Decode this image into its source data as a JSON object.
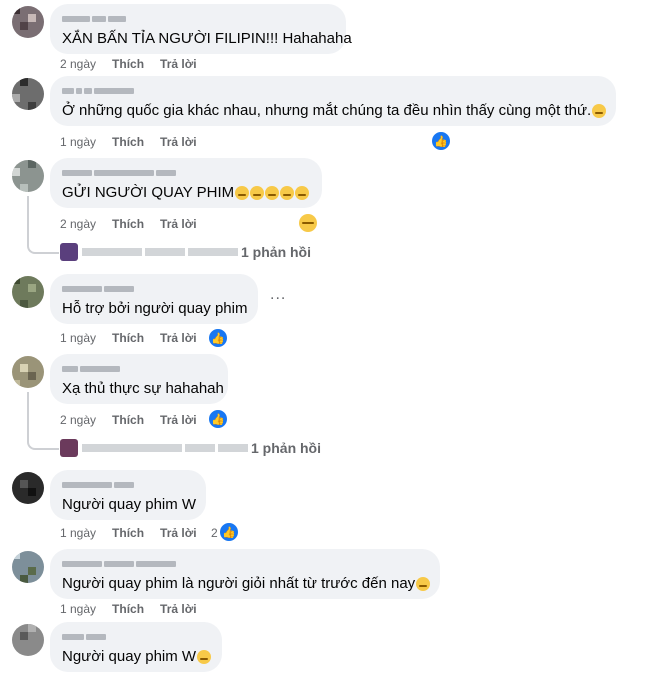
{
  "comments": [
    {
      "text": "XẮN BẤN TỈA NGƯỜI FILIPIN!!! Hahahaha",
      "time": "2 ngày",
      "like": "Thích",
      "reply": "Trả lời"
    },
    {
      "text": "Ở những quốc gia khác nhau, nhưng mắt chúng ta đều nhìn thấy cùng một thứ.",
      "time": "1 ngày",
      "like": "Thích",
      "reply": "Trả lời"
    },
    {
      "text": "GỬI NGƯỜI QUAY PHIM",
      "time": "2 ngày",
      "like": "Thích",
      "reply": "Trả lời",
      "replies": "1 phản hồi"
    },
    {
      "text": "Hỗ trợ bởi người quay phim",
      "time": "1 ngày",
      "like": "Thích",
      "reply": "Trả lời"
    },
    {
      "text": "Xạ thủ thực sự hahahah",
      "time": "2 ngày",
      "like": "Thích",
      "reply": "Trả lời",
      "replies": "1 phản hồi"
    },
    {
      "text": "Người quay phim W",
      "time": "1 ngày",
      "like": "Thích",
      "reply": "Trả lời",
      "reaction_count": "2"
    },
    {
      "text": "Người quay phim là người giỏi nhất từ trước đến nay",
      "time": "1 ngày",
      "like": "Thích",
      "reply": "Trả lời"
    },
    {
      "text": "Người quay phim W",
      "time": "",
      "like": "",
      "reply": ""
    }
  ],
  "more_label": "...",
  "colors": {
    "bubble": "#f0f2f5",
    "like": "#1877f2",
    "meta": "#65676b"
  }
}
